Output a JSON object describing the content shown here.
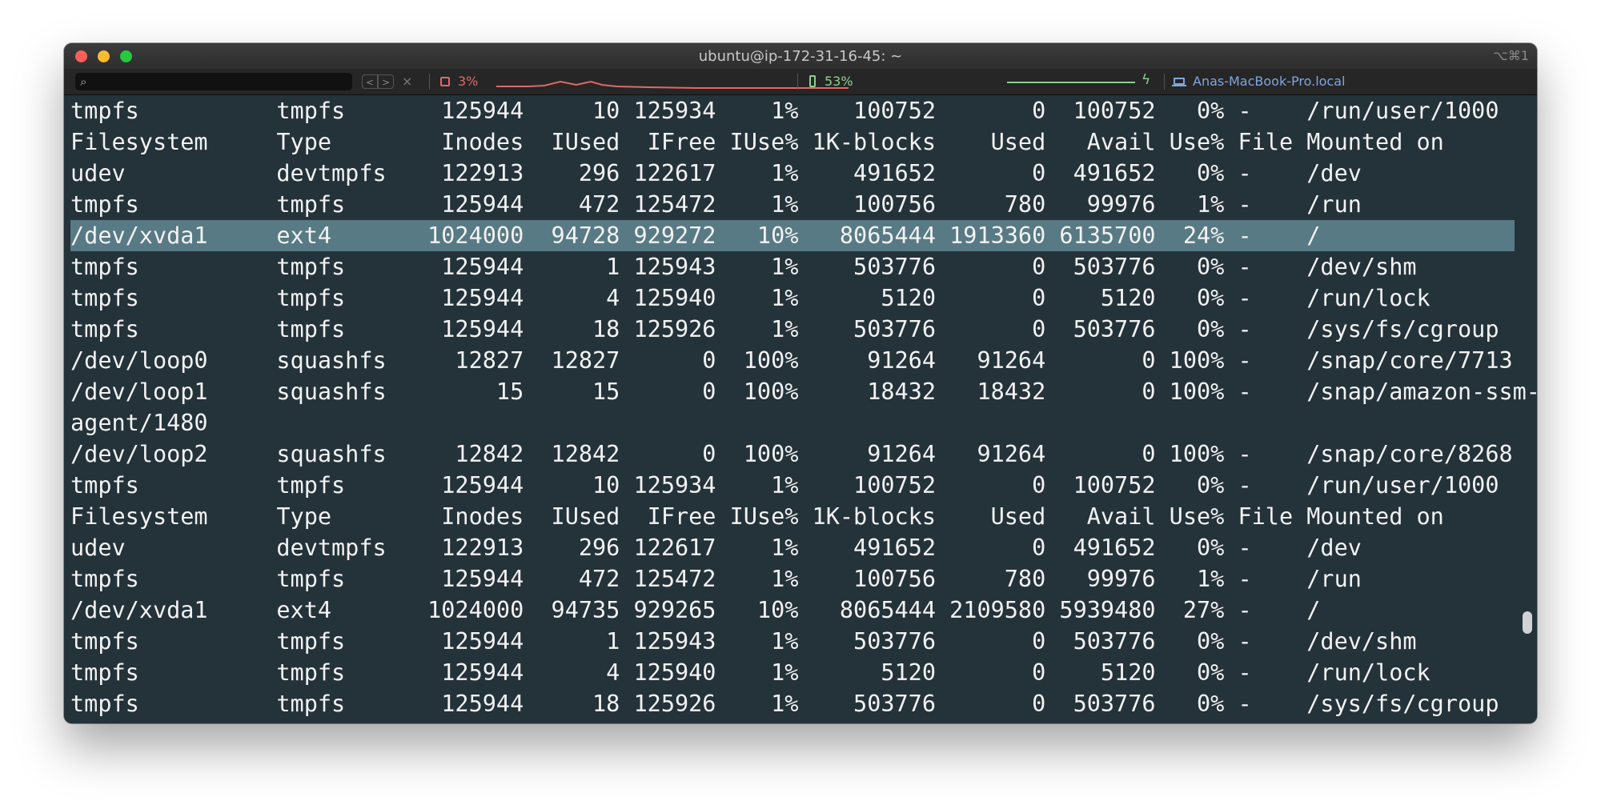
{
  "window": {
    "title": "ubuntu@ip-172-31-16-45: ~",
    "shortcut": "⌥⌘1"
  },
  "statusbar": {
    "search_placeholder": "",
    "search_icon": "search-icon",
    "prev_label": "<",
    "next_label": ">",
    "close_label": "×",
    "cpu": "3%",
    "battery": "53%",
    "host": "Anas-MacBook-Pro.local",
    "colors": {
      "cpu": "#e06868",
      "battery": "#8ed08e",
      "host": "#7fa6de"
    }
  },
  "terminal": {
    "background": "#24323a",
    "highlight": "#587a84",
    "lines": [
      "tmpfs          tmpfs       125944     10 125934    1%    100752       0  100752   0% -    /run/user/1000",
      "Filesystem     Type        Inodes  IUsed  IFree IUse% 1K-blocks    Used   Avail Use% File Mounted on",
      "udev           devtmpfs    122913    296 122617    1%    491652       0  491652   0% -    /dev",
      "tmpfs          tmpfs       125944    472 125472    1%    100756     780   99976   1% -    /run",
      "/dev/xvda1     ext4       1024000  94728 929272   10%   8065444 1913360 6135700  24% -    /",
      "tmpfs          tmpfs       125944      1 125943    1%    503776       0  503776   0% -    /dev/shm",
      "tmpfs          tmpfs       125944      4 125940    1%      5120       0    5120   0% -    /run/lock",
      "tmpfs          tmpfs       125944     18 125926    1%    503776       0  503776   0% -    /sys/fs/cgroup",
      "/dev/loop0     squashfs     12827  12827      0  100%     91264   91264       0 100% -    /snap/core/7713",
      "/dev/loop1     squashfs        15     15      0  100%     18432   18432       0 100% -    /snap/amazon-ssm-",
      "agent/1480",
      "/dev/loop2     squashfs     12842  12842      0  100%     91264   91264       0 100% -    /snap/core/8268",
      "tmpfs          tmpfs       125944     10 125934    1%    100752       0  100752   0% -    /run/user/1000",
      "Filesystem     Type        Inodes  IUsed  IFree IUse% 1K-blocks    Used   Avail Use% File Mounted on",
      "udev           devtmpfs    122913    296 122617    1%    491652       0  491652   0% -    /dev",
      "tmpfs          tmpfs       125944    472 125472    1%    100756     780   99976   1% -    /run",
      "/dev/xvda1     ext4       1024000  94735 929265   10%   8065444 2109580 5939480  27% -    /",
      "tmpfs          tmpfs       125944      1 125943    1%    503776       0  503776   0% -    /dev/shm",
      "tmpfs          tmpfs       125944      4 125940    1%      5120       0    5120   0% -    /run/lock",
      "tmpfs          tmpfs       125944     18 125926    1%    503776       0  503776   0% -    /sys/fs/cgroup"
    ]
  }
}
